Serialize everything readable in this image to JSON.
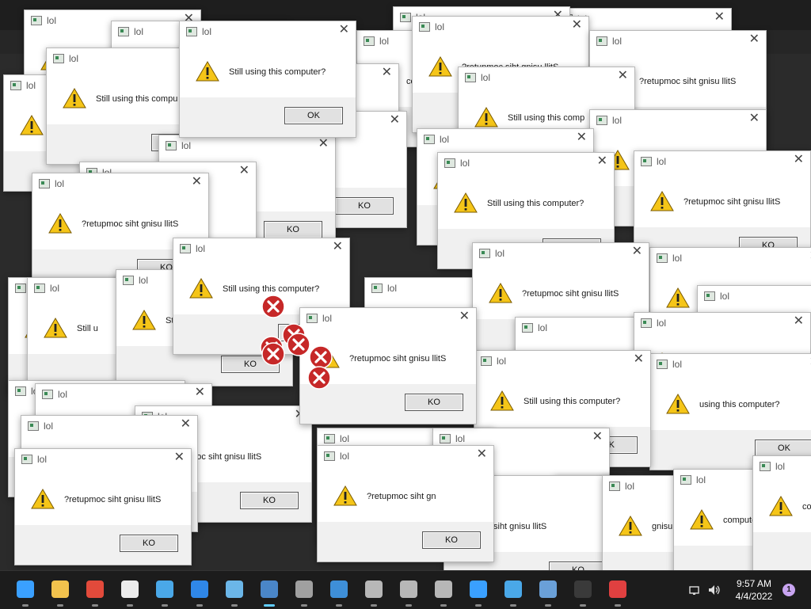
{
  "dialog_title": "lol",
  "message_normal": "Still using this computer?",
  "message_reversed": "?retupmoc siht gnisu llitS",
  "button_ok": "OK",
  "button_ko": "KO",
  "button_ko_dot": "KO.",
  "partial_texts": {
    "still_using_this_compu": "Still using this compu",
    "still_using_this_comp": "Still using this comp",
    "still_u": "Still u",
    "still": "Still",
    "st": "St",
    "ter": "ter?",
    "er": "er?",
    "computer": "computer?",
    "using_this_computer": "using this computer?",
    "retupm": "?retupm",
    "pmoc_siht_gnisu_llits": "pmoc siht gnisu llitS",
    "siht_gnisu_llits": "siht gnisu llitS",
    "gnisu_llits": "gnisu llitS",
    "retupmoc_siht_gn": "?retupmoc siht gn",
    "retupmoc_partial": "retupmoc",
    "p": "p",
    "k": "K",
    "ko_partial": "KO",
    "s": "S",
    "pl": "pl",
    "o": "O",
    "u": "u",
    "llits": "llitS"
  },
  "taskbar": {
    "items": [
      "start-icon",
      "file-explorer-icon",
      "chrome-icon",
      "7zip-icon",
      "notepad-icon",
      "photos-icon",
      "paint-icon",
      "active-app-icon",
      "calculator-icon",
      "control-panel-icon",
      "network-icon",
      "network-icon-2",
      "network-icon-3",
      "globe-icon",
      "puzzle-icon",
      "performance-icon",
      "terminal-icon",
      "toolbox-icon"
    ],
    "time": "9:57 AM",
    "date": "4/4/2022",
    "notification_count": "1"
  },
  "colors": {
    "warning_yellow": "#f5c518",
    "error_red": "#c62828",
    "taskbar_bg": "#1c1c1c",
    "accent": "#60cdff"
  }
}
